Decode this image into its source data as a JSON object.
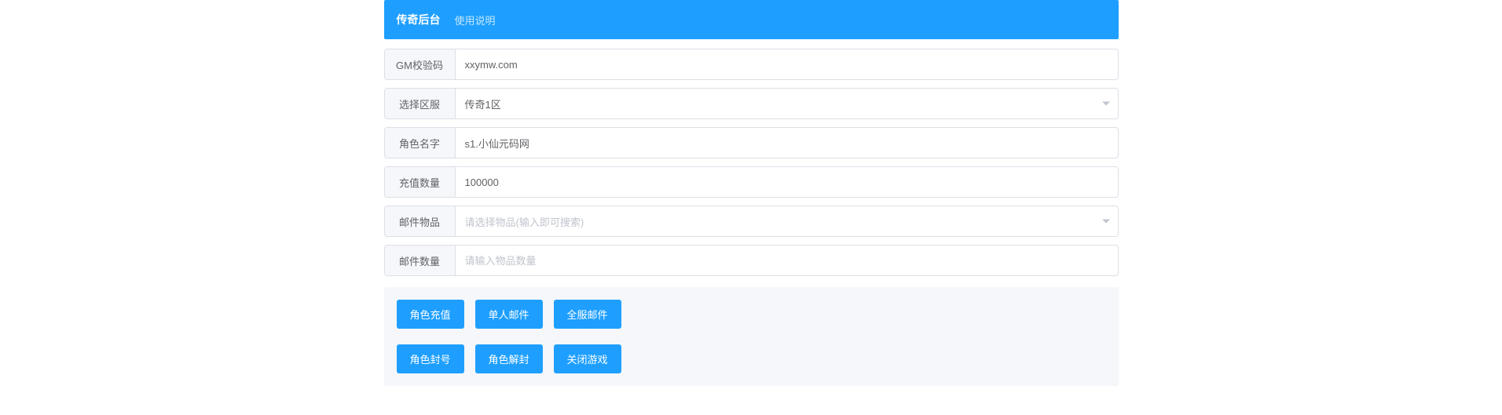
{
  "header": {
    "title": "传奇后台",
    "instructions_link": "使用说明"
  },
  "form": {
    "gm_code": {
      "label": "GM校验码",
      "value": "xxymw.com"
    },
    "server": {
      "label": "选择区服",
      "value": "传奇1区"
    },
    "role_name": {
      "label": "角色名字",
      "value": "s1.小仙元码网"
    },
    "recharge_amount": {
      "label": "充值数量",
      "value": "100000"
    },
    "mail_item": {
      "label": "邮件物品",
      "placeholder": "请选择物品(输入即可搜索)"
    },
    "mail_quantity": {
      "label": "邮件数量",
      "placeholder": "请输入物品数量"
    }
  },
  "buttons": {
    "row1": {
      "recharge": "角色充值",
      "single_mail": "单人邮件",
      "all_mail": "全服邮件"
    },
    "row2": {
      "ban": "角色封号",
      "unban": "角色解封",
      "close_game": "关闭游戏"
    }
  }
}
